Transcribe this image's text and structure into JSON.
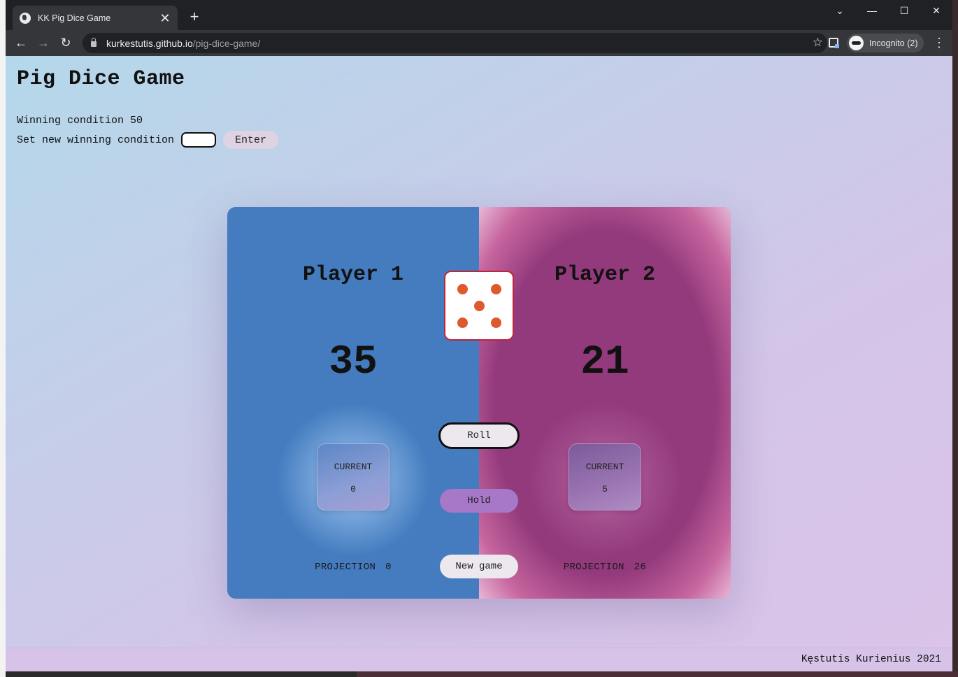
{
  "browser": {
    "tab_title": "KK Pig Dice Game",
    "tab_close": "✕",
    "new_tab": "+",
    "url_host": "kurkestutis.github.io",
    "url_path": "/pig-dice-game/",
    "profile_label": "Incognito (2)",
    "controls": {
      "tabsearch": "⌄",
      "minimize": "—",
      "maximize": "☐",
      "close": "✕"
    },
    "nav": {
      "back": "←",
      "forward": "→",
      "reload": "↻",
      "star": "☆",
      "menu": "⋮"
    }
  },
  "page": {
    "title": "Pig Dice Game",
    "winning_condition_label": "Winning condition",
    "winning_condition_value": "50",
    "set_new_label": "Set new winning condition",
    "input_value": "",
    "enter_button": "Enter"
  },
  "game": {
    "player1": {
      "name": "Player 1",
      "score": "35",
      "current_label": "CURRENT",
      "current": "0",
      "projection_label": "PROJECTION",
      "projection": "0"
    },
    "player2": {
      "name": "Player 2",
      "score": "21",
      "current_label": "CURRENT",
      "current": "5",
      "projection_label": "PROJECTION",
      "projection": "26"
    },
    "dice_value": 5,
    "active_player": 2,
    "roll_button": "Roll",
    "hold_button": "Hold",
    "new_game_button": "New game",
    "colors": {
      "player1": "#447cbf",
      "player2": "#933a7c",
      "pip": "#dc5a2e",
      "dice_border": "#c0263a",
      "hold": "#a777c8"
    }
  },
  "footer": {
    "text": "Kęstutis Kurienius 2021"
  }
}
